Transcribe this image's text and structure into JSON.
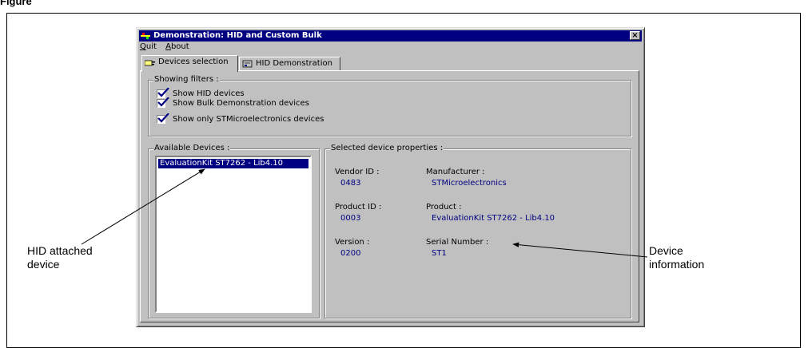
{
  "figure": {
    "caption": "Figure"
  },
  "window": {
    "title": "Demonstration: HID and Custom Bulk",
    "close_label": "×"
  },
  "menu": {
    "items": [
      "Quit",
      "About"
    ]
  },
  "tabs": [
    {
      "label": "Devices selection",
      "icon": "hand-pointer-icon",
      "active": true
    },
    {
      "label": "HID Demonstration",
      "icon": "device-icon",
      "active": false
    }
  ],
  "filters": {
    "label": "Showing filters :",
    "options": [
      {
        "label": "Show HID devices",
        "checked": true
      },
      {
        "label": "Show Bulk Demonstration devices",
        "checked": true
      },
      {
        "label": "Show only STMicroelectronics devices",
        "checked": true
      }
    ]
  },
  "available": {
    "label": "Available Devices :",
    "items": [
      "EvaluationKit ST7262 - Lib4.10"
    ]
  },
  "properties": {
    "label": "Selected device properties :",
    "vendor_id": {
      "label": "Vendor ID :",
      "value": "0483"
    },
    "manufacturer": {
      "label": "Manufacturer :",
      "value": "STMicroelectronics"
    },
    "product_id": {
      "label": "Product ID :",
      "value": "0003"
    },
    "product": {
      "label": "Product :",
      "value": "EvaluationKit ST7262 - Lib4.10"
    },
    "version": {
      "label": "Version :",
      "value": "0200"
    },
    "serial": {
      "label": "Serial Number :",
      "value": "ST1"
    }
  },
  "callouts": {
    "left": {
      "line1": "HID attached",
      "line2": "device"
    },
    "right": {
      "line1": "Device",
      "line2": "information"
    }
  },
  "colors": {
    "titlebar": "#000080",
    "face": "#c0c0c0",
    "value": "#000080"
  }
}
